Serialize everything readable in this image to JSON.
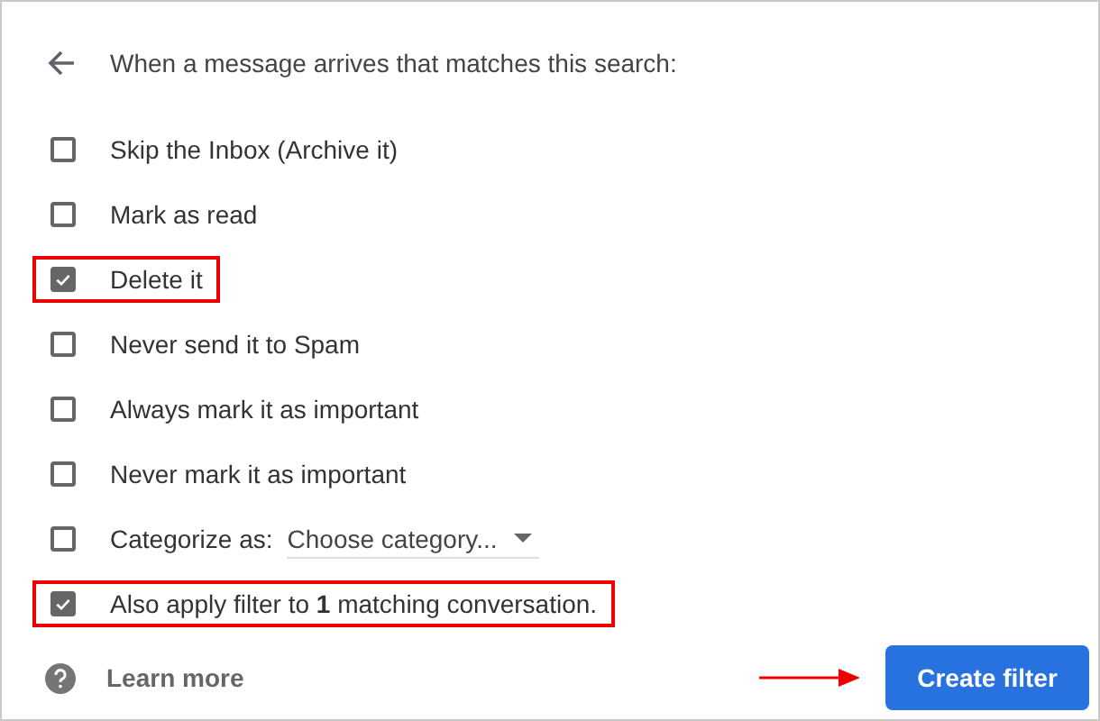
{
  "header": {
    "text": "When a message arrives that matches this search:"
  },
  "options": [
    {
      "kind": "checkbox",
      "label": "Skip the Inbox (Archive it)",
      "checked": false,
      "highlighted": false
    },
    {
      "kind": "checkbox",
      "label": "Mark as read",
      "checked": false,
      "highlighted": false
    },
    {
      "kind": "checkbox",
      "label": "Delete it",
      "checked": true,
      "highlighted": true
    },
    {
      "kind": "checkbox",
      "label": "Never send it to Spam",
      "checked": false,
      "highlighted": false
    },
    {
      "kind": "checkbox",
      "label": "Always mark it as important",
      "checked": false,
      "highlighted": false
    },
    {
      "kind": "checkbox",
      "label": "Never mark it as important",
      "checked": false,
      "highlighted": false
    },
    {
      "kind": "category",
      "label": "Categorize as:",
      "dropdown": "Choose category...",
      "checked": false,
      "highlighted": false
    },
    {
      "kind": "checkbox",
      "label": "Also apply filter to **1** matching conversation.",
      "checked": true,
      "highlighted": true
    }
  ],
  "footer": {
    "link": "Learn more",
    "button": "Create filter",
    "arrow": true
  }
}
